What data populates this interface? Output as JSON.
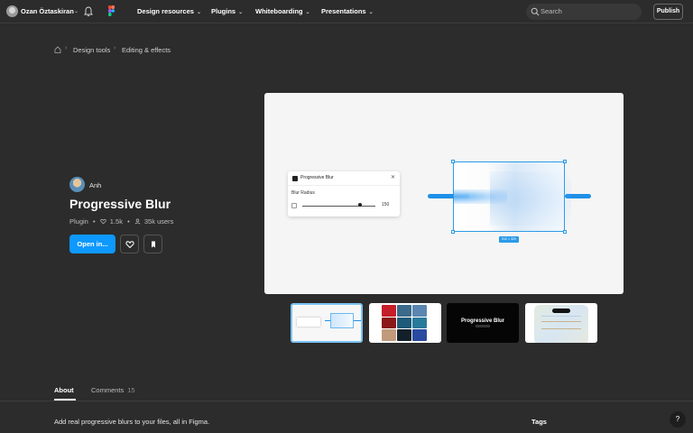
{
  "topbar": {
    "user_name": "Ozan Öztaskiran",
    "nav": [
      {
        "label": "Design resources"
      },
      {
        "label": "Plugins"
      },
      {
        "label": "Whiteboarding"
      },
      {
        "label": "Presentations"
      }
    ],
    "chevron": "⌄",
    "search_placeholder": "Search",
    "publish_label": "Publish"
  },
  "breadcrumb": {
    "items": [
      "Design tools",
      "Editing & effects"
    ],
    "separator": "›"
  },
  "plugin": {
    "author": "Anh",
    "title": "Progressive Blur",
    "type": "Plugin",
    "likes": "1.5k",
    "users": "35k users",
    "open_label": "Open in..."
  },
  "preview": {
    "panel_title": "Progressive Blur",
    "panel_close": "✕",
    "blur_label": "Blur Radius",
    "blur_value": "150",
    "dimension_label": "512 × 320"
  },
  "thumbnails": {
    "thumb3_text": "Progressive Blur"
  },
  "tabs": {
    "about": "About",
    "comments": "Comments",
    "comments_count": "15"
  },
  "about": {
    "description": "Add real progressive blurs to your files, all in Figma.",
    "tags_heading": "Tags"
  },
  "help_label": "?",
  "colors": {
    "background": "#2c2c2c",
    "accent": "#0d99ff",
    "selection": "#2b9be8"
  }
}
